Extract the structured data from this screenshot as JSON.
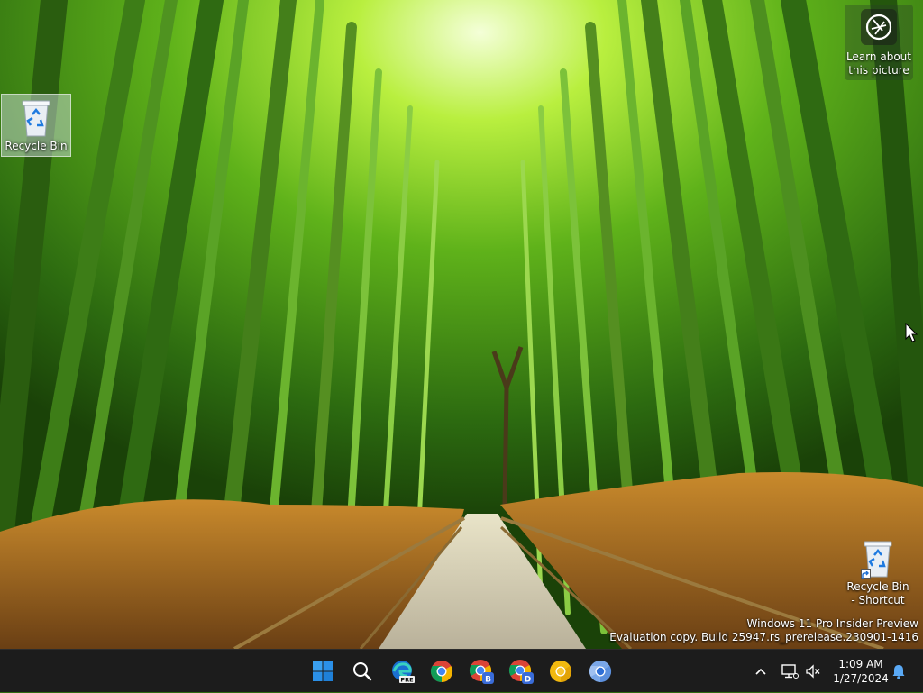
{
  "desktop": {
    "icons": [
      {
        "label": "Recycle Bin",
        "icon": "recycle-bin-icon"
      },
      {
        "label": "Recycle Bin - Shortcut",
        "icon": "recycle-bin-shortcut-icon"
      }
    ],
    "spotlight": {
      "label": "Learn about this picture",
      "icon": "camera-icon"
    },
    "watermark": {
      "line1": "Windows 11 Pro Insider Preview",
      "line2": "Evaluation copy. Build 25947.rs_prerelease.230901-1416"
    }
  },
  "taskbar": {
    "pinned": [
      {
        "name": "Start",
        "icon": "windows-start-icon"
      },
      {
        "name": "Search",
        "icon": "search-icon"
      },
      {
        "name": "Microsoft Edge Canary",
        "icon": "edge-pre-icon",
        "badge": "PRE"
      },
      {
        "name": "Google Chrome",
        "icon": "chrome-icon"
      },
      {
        "name": "Google Chrome Beta",
        "icon": "chrome-beta-icon",
        "badge": "B"
      },
      {
        "name": "Google Chrome Dev",
        "icon": "chrome-dev-icon",
        "badge": "D"
      },
      {
        "name": "Google Chrome Canary",
        "icon": "chrome-canary-icon"
      },
      {
        "name": "Chromium",
        "icon": "chromium-icon"
      }
    ],
    "tray": {
      "time": "1:09 AM",
      "date": "1/27/2024",
      "icons": [
        "chevron-up-icon",
        "network-icon",
        "volume-muted-icon",
        "notification-bell-icon"
      ]
    }
  },
  "colors": {
    "taskbar_bg": "#1c1c1c",
    "accent_blue": "#1f7ae0",
    "chrome_red": "#db4437",
    "chrome_yellow": "#f4b400",
    "chrome_green": "#0f9d58"
  }
}
